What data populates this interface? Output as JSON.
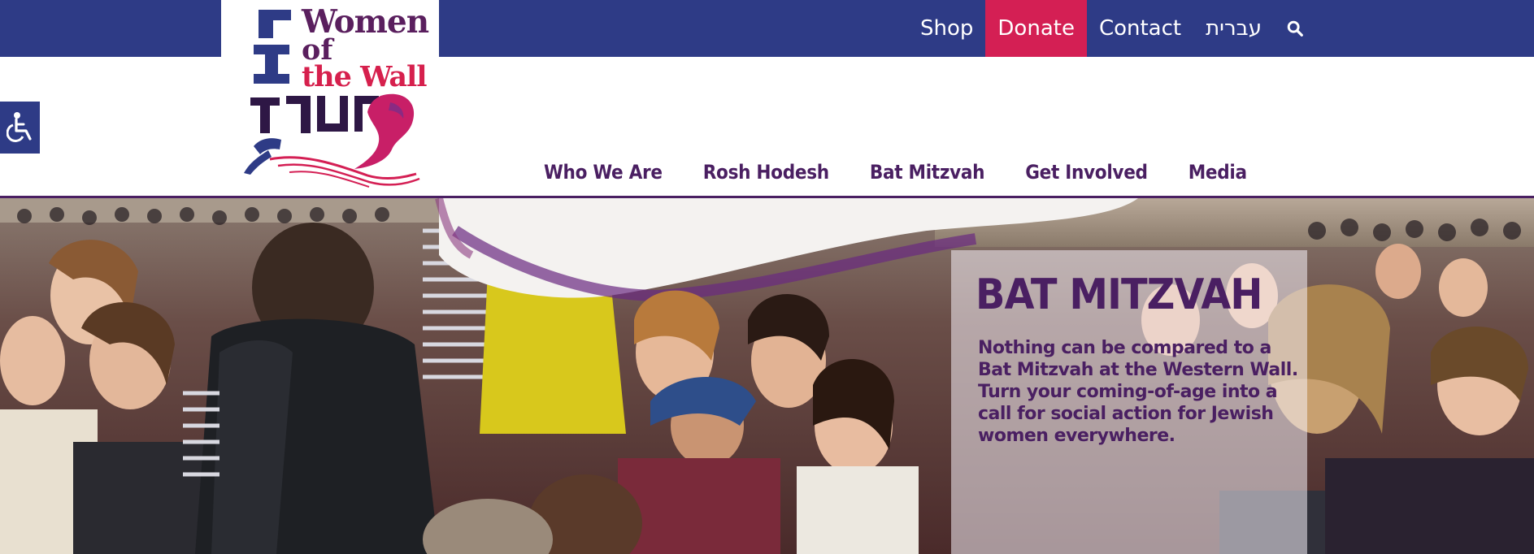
{
  "brand": {
    "logo_lines": [
      "Women",
      "of",
      "the Wall"
    ],
    "logo_hebrew": "נשות",
    "colors": {
      "navy": "#2e3b86",
      "purple": "#4a1f62",
      "crimson": "#d41f54"
    }
  },
  "util_nav": {
    "items": [
      {
        "label": "Shop"
      },
      {
        "label": "Donate"
      },
      {
        "label": "Contact"
      },
      {
        "label": "עברית"
      }
    ],
    "search_icon": "search-icon"
  },
  "accessibility": {
    "icon": "wheelchair-icon"
  },
  "main_nav": {
    "items": [
      {
        "label": "Who We Are"
      },
      {
        "label": "Rosh Hodesh"
      },
      {
        "label": "Bat Mitzvah"
      },
      {
        "label": "Get Involved"
      },
      {
        "label": "Media"
      }
    ]
  },
  "hero": {
    "title": "BAT MITZVAH",
    "text": "Nothing can be compared to a Bat Mitzvah at the Western Wall. Turn your coming-of-age into a call for social action for Jewish women everywhere."
  }
}
